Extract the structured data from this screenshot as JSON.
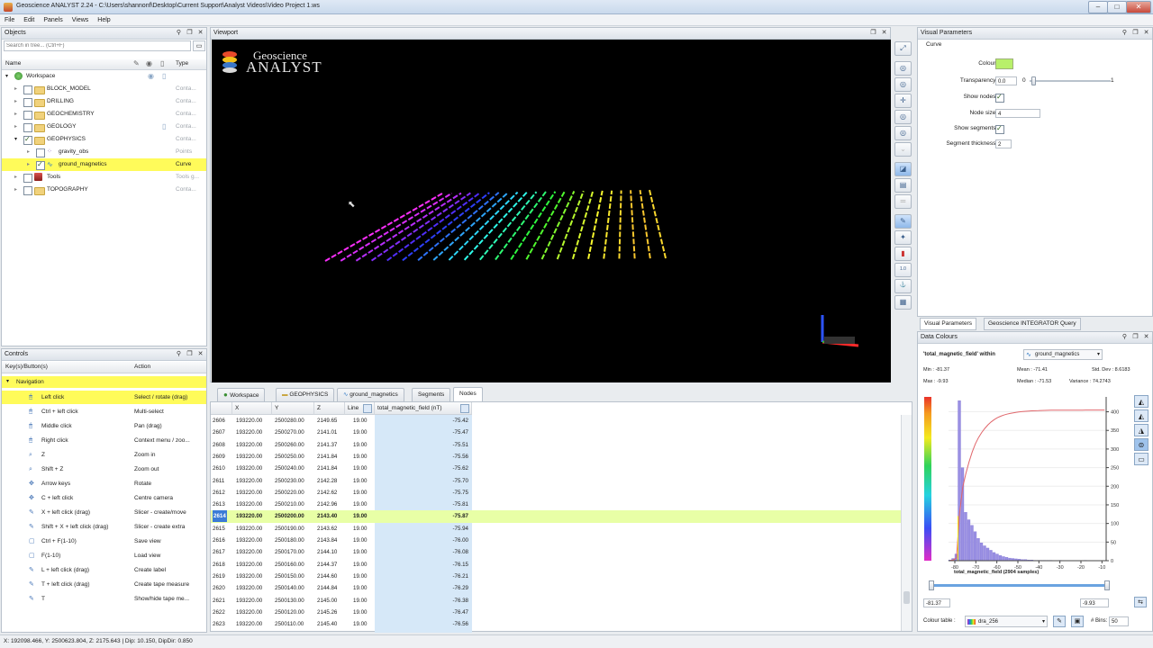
{
  "window": {
    "title": "Geoscience ANALYST 2.24 - C:\\Users\\shannonf\\Desktop\\Current Support\\Analyst Videos\\Video Project 1.ws",
    "minimize": "–",
    "maximize": "□",
    "close": "✕"
  },
  "menu": [
    "File",
    "Edit",
    "Panels",
    "Views",
    "Help"
  ],
  "objects_panel": {
    "title": "Objects",
    "search_placeholder": "Search in tree... (Ctrl+F)",
    "col_name": "Name",
    "col_type": "Type",
    "items": [
      {
        "label": "Workspace",
        "type": ""
      },
      {
        "label": "BLOCK_MODEL",
        "type": "Conta..."
      },
      {
        "label": "DRILLING",
        "type": "Conta..."
      },
      {
        "label": "GEOCHEMISTRY",
        "type": "Conta..."
      },
      {
        "label": "GEOLOGY",
        "type": "Conta..."
      },
      {
        "label": "GEOPHYSICS",
        "type": "Conta..."
      },
      {
        "label": "gravity_obs",
        "type": "Points"
      },
      {
        "label": "ground_magnetics",
        "type": "Curve"
      },
      {
        "label": "Tools",
        "type": "Tools g..."
      },
      {
        "label": "TOPOGRAPHY",
        "type": "Conta..."
      }
    ]
  },
  "controls_panel": {
    "title": "Controls",
    "col_keys": "Key(s)/Button(s)",
    "col_action": "Action",
    "group": "Navigation",
    "rows": [
      {
        "key": "Left click",
        "action": "Select / rotate (drag)"
      },
      {
        "key": "Ctrl + left click",
        "action": "Multi-select"
      },
      {
        "key": "Middle click",
        "action": "Pan (drag)"
      },
      {
        "key": "Right click",
        "action": "Context menu / zoo..."
      },
      {
        "key": "Z",
        "action": "Zoom in"
      },
      {
        "key": "Shift + Z",
        "action": "Zoom out"
      },
      {
        "key": "Arrow keys",
        "action": "Rotate"
      },
      {
        "key": "C + left click",
        "action": "Centre camera"
      },
      {
        "key": "X + left click (drag)",
        "action": "Slicer - create/move"
      },
      {
        "key": "Shift + X + left click (drag)",
        "action": "Slicer - create extra"
      },
      {
        "key": "Ctrl + F(1-10)",
        "action": "Save view"
      },
      {
        "key": "F(1-10)",
        "action": "Load view"
      },
      {
        "key": "L + left click (drag)",
        "action": "Create label"
      },
      {
        "key": "T + left click (drag)",
        "action": "Create tape measure"
      },
      {
        "key": "T",
        "action": "Show/hide tape me..."
      }
    ]
  },
  "viewport": {
    "title": "Viewport",
    "logo_line1": "Geoscience",
    "logo_line2": "ANALYST"
  },
  "table_tabs": [
    "Workspace",
    "GEOPHYSICS",
    "ground_magnetics",
    "Segments",
    "Nodes"
  ],
  "table": {
    "headers": [
      "",
      "X",
      "Y",
      "Z",
      "Line",
      "total_magnetic_field (nT)"
    ],
    "rows": [
      [
        "2606",
        "193220.00",
        "2500280.00",
        "2149.65",
        "19.00",
        "-75.42"
      ],
      [
        "2607",
        "193220.00",
        "2500270.00",
        "2141.01",
        "19.00",
        "-75.47"
      ],
      [
        "2608",
        "193220.00",
        "2500260.00",
        "2141.37",
        "19.00",
        "-75.51"
      ],
      [
        "2609",
        "193220.00",
        "2500250.00",
        "2141.84",
        "19.00",
        "-75.56"
      ],
      [
        "2610",
        "193220.00",
        "2500240.00",
        "2141.84",
        "19.00",
        "-75.62"
      ],
      [
        "2611",
        "193220.00",
        "2500230.00",
        "2142.28",
        "19.00",
        "-75.70"
      ],
      [
        "2612",
        "193220.00",
        "2500220.00",
        "2142.62",
        "19.00",
        "-75.75"
      ],
      [
        "2613",
        "193220.00",
        "2500210.00",
        "2142.96",
        "19.00",
        "-75.81"
      ],
      [
        "2614",
        "193220.00",
        "2500200.00",
        "2143.40",
        "19.00",
        "-75.87"
      ],
      [
        "2615",
        "193220.00",
        "2500190.00",
        "2143.62",
        "19.00",
        "-75.94"
      ],
      [
        "2616",
        "193220.00",
        "2500180.00",
        "2143.84",
        "19.00",
        "-76.00"
      ],
      [
        "2617",
        "193220.00",
        "2500170.00",
        "2144.10",
        "19.00",
        "-76.08"
      ],
      [
        "2618",
        "193220.00",
        "2500160.00",
        "2144.37",
        "19.00",
        "-76.15"
      ],
      [
        "2619",
        "193220.00",
        "2500150.00",
        "2144.60",
        "19.00",
        "-76.21"
      ],
      [
        "2620",
        "193220.00",
        "2500140.00",
        "2144.84",
        "19.00",
        "-76.29"
      ],
      [
        "2621",
        "193220.00",
        "2500130.00",
        "2145.00",
        "19.00",
        "-76.38"
      ],
      [
        "2622",
        "193220.00",
        "2500120.00",
        "2145.26",
        "19.00",
        "-76.47"
      ],
      [
        "2623",
        "193220.00",
        "2500110.00",
        "2145.40",
        "19.00",
        "-76.56"
      ]
    ]
  },
  "visual_parameters": {
    "title": "Visual Parameters",
    "section": "Curve",
    "colour_label": "Colour :",
    "colour": "#b8f06a",
    "transparency_label": "Transparency :",
    "transparency_value": "0.0",
    "transparency_min": "0",
    "transparency_max": "1",
    "show_nodes_label": "Show nodes :",
    "node_size_label": "Node size :",
    "node_size": "4",
    "show_segments_label": "Show segments :",
    "segment_thickness_label": "Segment thickness :",
    "segment_thickness": "2"
  },
  "bottom_tabs": [
    "Visual Parameters",
    "Geoscience INTEGRATOR Query"
  ],
  "data_colours": {
    "title": "Data Colours",
    "field_label": "'total_magnetic_field' within",
    "object": "ground_magnetics",
    "min": "Min : -81.37",
    "mean": "Mean : -71.41",
    "std": "Std. Dev : 8.6183",
    "max": "Max : -9.93",
    "median": "Median : -71.53",
    "variance": "Variance : 74.2743",
    "xlabel": "total_magnetic_field (2904 samples)",
    "range_min": "-81.37",
    "range_max": "-9.93",
    "colour_table_label": "Colour table :",
    "colour_table": "dra_256",
    "bins_label": "# Bins:",
    "bins": "50",
    "xticks": [
      "-80",
      "-70",
      "-60",
      "-50",
      "-40",
      "-30",
      "-20",
      "-10"
    ],
    "yticks": [
      "0",
      "50",
      "100",
      "150",
      "200",
      "250",
      "300",
      "350",
      "400"
    ]
  },
  "status": "X: 192098.466, Y: 2500623.804, Z: 2175.643 | Dip: 10.150, DipDir: 0.850"
}
